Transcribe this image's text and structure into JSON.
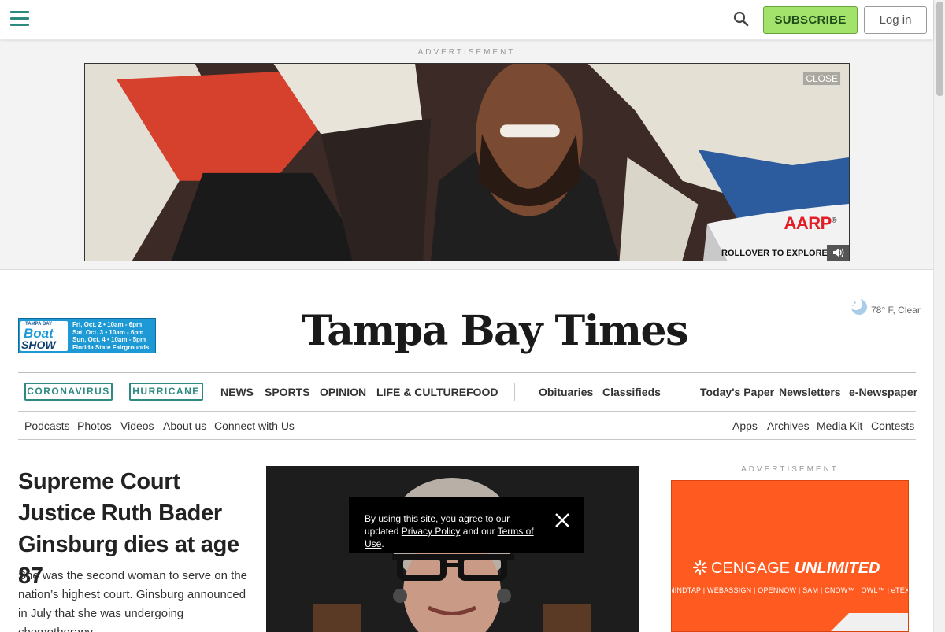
{
  "header": {
    "subscribe_label": "SUBSCRIBE",
    "login_label": "Log in",
    "menu_icon": "hamburger-menu-icon",
    "search_icon": "search-icon",
    "accent_color": "#2e8a7f",
    "subscribe_color": "#a3e36b"
  },
  "top_ad": {
    "label": "ADVERTISEMENT",
    "close_label": "CLOSE",
    "brand": "AARP",
    "registered": "®",
    "rollover_label": "ROLLOVER TO EXPLORE",
    "mute_icon": "speaker-icon"
  },
  "masthead": {
    "title": "Tampa Bay Times",
    "weather": "78° F, Clear",
    "weather_icon": "moon-cloud-icon",
    "promo": {
      "small": "TAMPA BAY",
      "word1": "Boat",
      "word2": "SHOW",
      "line1": "Fri, Oct. 2 • 10am - 6pm",
      "line2": "Sat, Oct. 3 • 10am - 6pm",
      "line3": "Sun, Oct. 4 • 10am - 5pm",
      "line4": "Florida State Fairgrounds"
    }
  },
  "nav": {
    "chips": [
      "CORONAVIRUS",
      "HURRICANE"
    ],
    "sections": [
      "NEWS",
      "SPORTS",
      "OPINION",
      "LIFE & CULTURE",
      "FOOD"
    ],
    "middle": [
      "Obituaries",
      "Classifieds"
    ],
    "right": [
      "Today's Paper",
      "Newsletters",
      "e-Newspaper"
    ]
  },
  "subnav": {
    "left": [
      "Podcasts",
      "Photos",
      "Videos",
      "About us",
      "Connect with Us"
    ],
    "right": [
      "Apps",
      "Archives",
      "Media Kit",
      "Contests"
    ]
  },
  "lead_story": {
    "headline": "Supreme Court Justice Ruth Bader Ginsburg dies at age 87",
    "summary": "She was the second woman to serve on the nation’s highest court. Ginsburg announced in July that she was undergoing chemotherapy."
  },
  "consent": {
    "text_before": "By using this site, you agree to our updated",
    "privacy_link": "Privacy Policy",
    "text_middle": "and our",
    "terms_link": "Terms of Use",
    "text_after": ".",
    "close_icon": "close-icon"
  },
  "side_ad": {
    "label": "ADVERTISEMENT",
    "brand_light": "CENGAGE",
    "brand_bold": "UNLIMITED",
    "products": "MINDTAP | WEBASSIGN | OPENNOW | SAM | CNOW™ | OWL™ | eTEXTBOOKS",
    "color": "#ff5a1f"
  }
}
